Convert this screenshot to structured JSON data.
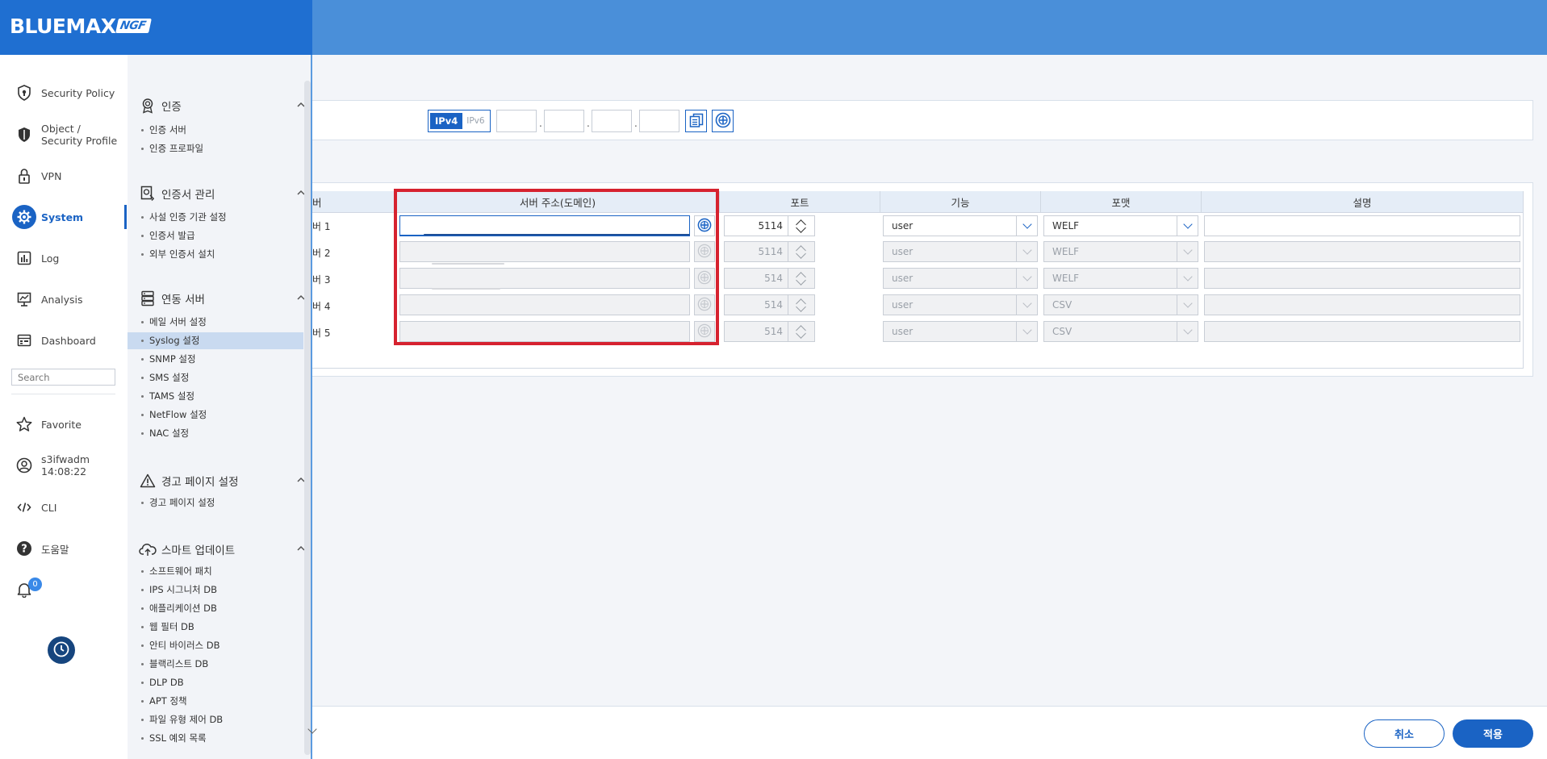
{
  "app": {
    "brand": "BLUEMAX",
    "brand_suffix": "NGF"
  },
  "nav": {
    "items": [
      {
        "label": "Security Policy",
        "icon": "shield-icon"
      },
      {
        "label": "Object /",
        "label2": "Security Profile",
        "icon": "shield-object-icon"
      },
      {
        "label": "VPN",
        "icon": "lock-icon"
      },
      {
        "label": "System",
        "icon": "gear-icon",
        "active": true
      },
      {
        "label": "Log",
        "icon": "log-chart-icon"
      },
      {
        "label": "Analysis",
        "icon": "analysis-icon"
      },
      {
        "label": "Dashboard",
        "icon": "dashboard-icon"
      }
    ],
    "search_placeholder": "Search",
    "bottom": [
      {
        "label": "Favorite",
        "icon": "star-icon"
      },
      {
        "label": "s3ifwadm",
        "label2": "14:08:22",
        "icon": "user-icon"
      },
      {
        "label": "CLI",
        "icon": "code-icon"
      },
      {
        "label": "도움말",
        "icon": "help-icon"
      }
    ],
    "notification_count": "0"
  },
  "submenu": {
    "sections": [
      {
        "title": "인증",
        "icon": "certificate-badge-icon",
        "items": [
          "인증 서버",
          "인증 프로파일"
        ]
      },
      {
        "title": "인증서 관리",
        "icon": "cert-management-icon",
        "items": [
          "사설 인증 기관 설정",
          "인증서 발급",
          "외부 인증서 설치"
        ]
      },
      {
        "title": "연동 서버",
        "icon": "server-icon",
        "items": [
          "메일 서버 설정",
          "Syslog 설정",
          "SNMP 설정",
          "SMS 설정",
          "TAMS 설정",
          "NetFlow 설정",
          "NAC 설정"
        ]
      },
      {
        "title": "경고 페이지 설정",
        "icon": "warning-icon",
        "items": [
          "경고 페이지 설정"
        ]
      },
      {
        "title": "스마트 업데이트",
        "icon": "cloud-update-icon",
        "items": [
          "소프트웨어 패치",
          "IPS 시그니처 DB",
          "애플리케이션 DB",
          "웹 필터 DB",
          "안티 바이러스 DB",
          "블랙리스트 DB",
          "DLP DB",
          "APT 정책",
          "파일 유형 제어 DB",
          "SSL 예외 목록"
        ]
      }
    ],
    "selected": "Syslog 설정"
  },
  "ip_panel": {
    "ipv4": "IPv4",
    "ipv6": "IPv6"
  },
  "table": {
    "headers": [
      "버",
      "서버 주소(도메인)",
      "포트",
      "기능",
      "포맷",
      "설명"
    ],
    "rows": [
      {
        "label": "버 1",
        "port": "5114",
        "facility": "user",
        "format": "WELF",
        "enabled": true
      },
      {
        "label": "버 2",
        "port": "5114",
        "facility": "user",
        "format": "WELF",
        "enabled": false
      },
      {
        "label": "버 3",
        "port": "514",
        "facility": "user",
        "format": "WELF",
        "enabled": false
      },
      {
        "label": "버 4",
        "port": "514",
        "facility": "user",
        "format": "CSV",
        "enabled": false
      },
      {
        "label": "버 5",
        "port": "514",
        "facility": "user",
        "format": "CSV",
        "enabled": false
      }
    ]
  },
  "footer": {
    "cancel": "취소",
    "apply": "적용"
  },
  "colors": {
    "primary": "#1a63c4",
    "header": "#4a8fd9",
    "highlight": "#d6222f"
  }
}
